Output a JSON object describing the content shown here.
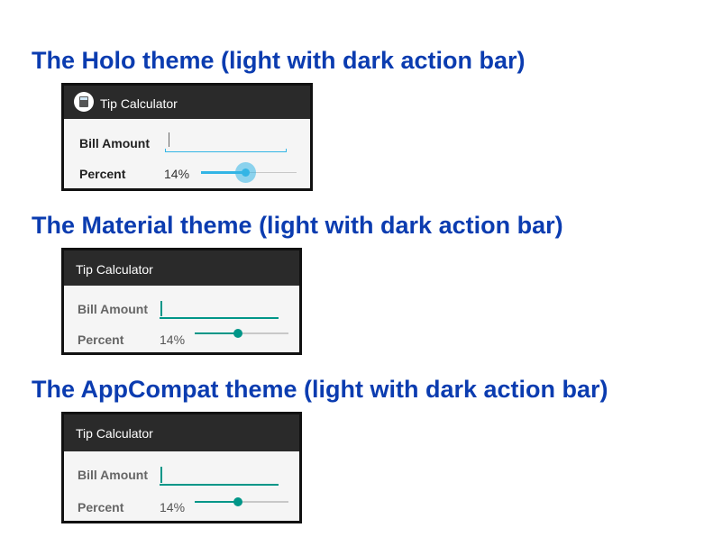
{
  "sections": [
    {
      "heading": "The Holo theme (light with dark action bar)",
      "app": {
        "title": "Tip Calculator",
        "icon": "calculator-icon",
        "bill_label": "Bill Amount",
        "bill_value": "",
        "percent_label": "Percent",
        "percent_value": "14%",
        "slider_fraction": 0.45,
        "accent_color": "#33b5e5"
      }
    },
    {
      "heading": "The Material theme (light with dark action bar)",
      "app": {
        "title": "Tip Calculator",
        "bill_label": "Bill Amount",
        "bill_value": "",
        "percent_label": "Percent",
        "percent_value": "14%",
        "slider_fraction": 0.47,
        "accent_color": "#009688"
      }
    },
    {
      "heading": "The AppCompat theme (light with dark action bar)",
      "app": {
        "title": "Tip Calculator",
        "bill_label": "Bill Amount",
        "bill_value": "",
        "percent_label": "Percent",
        "percent_value": "14%",
        "slider_fraction": 0.47,
        "accent_color": "#009688"
      }
    }
  ]
}
